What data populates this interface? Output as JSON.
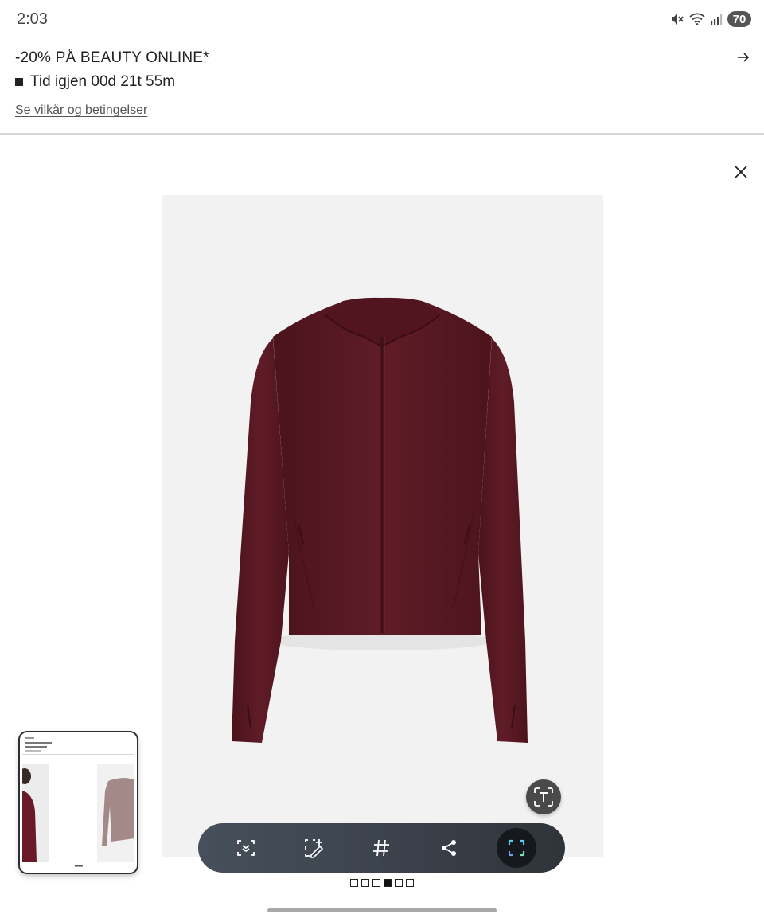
{
  "status_bar": {
    "time": "2:03",
    "battery": "70",
    "icons": [
      "mute-icon",
      "wifi-icon",
      "signal-icon",
      "battery-icon"
    ]
  },
  "promo": {
    "title": "-20% PÅ BEAUTY ONLINE*",
    "timer": "Tid igjen 00d 21t 55m",
    "terms_link": "Se vilkår og betingelser"
  },
  "product": {
    "color": "#5a1a24",
    "background": "#f2f2f2"
  },
  "gallery": {
    "total": 6,
    "active_index": 3
  },
  "toolbar": {
    "items": [
      "smart-select-icon",
      "draw-icon",
      "hashtag-icon",
      "share-icon",
      "capture-icon"
    ],
    "accent": "#5ad1e6"
  }
}
